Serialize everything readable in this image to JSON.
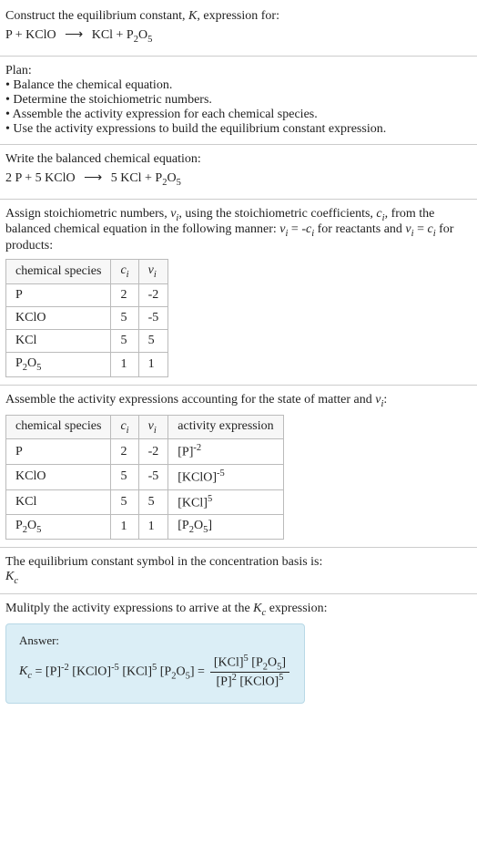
{
  "intro": {
    "line1": "Construct the equilibrium constant, K, expression for:",
    "eq_lhs": "P + KClO",
    "eq_rhs": "KCl + P₂O₅"
  },
  "plan": {
    "heading": "Plan:",
    "items": [
      "• Balance the chemical equation.",
      "• Determine the stoichiometric numbers.",
      "• Assemble the activity expression for each chemical species.",
      "• Use the activity expressions to build the equilibrium constant expression."
    ]
  },
  "balanced": {
    "heading": "Write the balanced chemical equation:",
    "eq_lhs": "2 P + 5 KClO",
    "eq_rhs": "5 KCl + P₂O₅"
  },
  "stoich": {
    "text_a": "Assign stoichiometric numbers, νᵢ, using the stoichiometric coefficients, cᵢ, from the balanced chemical equation in the following manner: νᵢ = -cᵢ for reactants and νᵢ = cᵢ for products:",
    "headers": {
      "a": "chemical species",
      "b": "cᵢ",
      "c": "νᵢ"
    },
    "rows": [
      {
        "sp": "P",
        "c": "2",
        "v": "-2"
      },
      {
        "sp": "KClO",
        "c": "5",
        "v": "-5"
      },
      {
        "sp": "KCl",
        "c": "5",
        "v": "5"
      },
      {
        "sp": "P₂O₅",
        "c": "1",
        "v": "1"
      }
    ]
  },
  "activity": {
    "text": "Assemble the activity expressions accounting for the state of matter and νᵢ:",
    "headers": {
      "a": "chemical species",
      "b": "cᵢ",
      "c": "νᵢ",
      "d": "activity expression"
    },
    "rows": [
      {
        "sp": "P",
        "c": "2",
        "v": "-2",
        "ae": "[P]⁻²"
      },
      {
        "sp": "KClO",
        "c": "5",
        "v": "-5",
        "ae": "[KClO]⁻⁵"
      },
      {
        "sp": "KCl",
        "c": "5",
        "v": "5",
        "ae": "[KCl]⁵"
      },
      {
        "sp": "P₂O₅",
        "c": "1",
        "v": "1",
        "ae": "[P₂O₅]"
      }
    ]
  },
  "symbol": {
    "text": "The equilibrium constant symbol in the concentration basis is:",
    "sym": "K꜀"
  },
  "multiply": {
    "text": "Mulitply the activity expressions to arrive at the K꜀ expression:"
  },
  "answer": {
    "label": "Answer:",
    "lhs": "K꜀ = [P]⁻² [KClO]⁻⁵ [KCl]⁵ [P₂O₅] =",
    "frac_num": "[KCl]⁵ [P₂O₅]",
    "frac_den": "[P]² [KClO]⁵"
  },
  "chart_data": {
    "type": "table",
    "tables": [
      {
        "title": "Stoichiometric numbers",
        "columns": [
          "chemical species",
          "c_i",
          "ν_i"
        ],
        "rows": [
          [
            "P",
            2,
            -2
          ],
          [
            "KClO",
            5,
            -5
          ],
          [
            "KCl",
            5,
            5
          ],
          [
            "P2O5",
            1,
            1
          ]
        ]
      },
      {
        "title": "Activity expressions",
        "columns": [
          "chemical species",
          "c_i",
          "ν_i",
          "activity expression"
        ],
        "rows": [
          [
            "P",
            2,
            -2,
            "[P]^-2"
          ],
          [
            "KClO",
            5,
            -5,
            "[KClO]^-5"
          ],
          [
            "KCl",
            5,
            5,
            "[KCl]^5"
          ],
          [
            "P2O5",
            1,
            1,
            "[P2O5]"
          ]
        ]
      }
    ],
    "balanced_equation": "2 P + 5 KClO -> 5 KCl + P2O5",
    "Kc": "([KCl]^5 * [P2O5]) / ([P]^2 * [KClO]^5)"
  }
}
